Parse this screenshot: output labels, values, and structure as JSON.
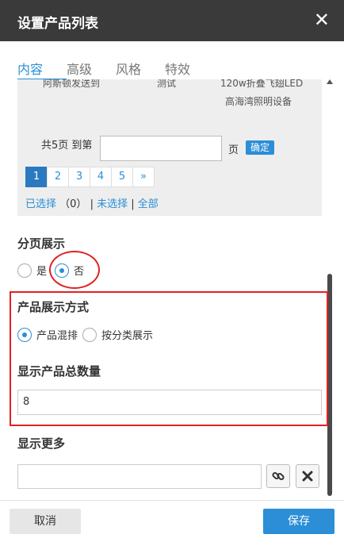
{
  "dialog": {
    "title": "设置产品列表",
    "close_glyph": "✕"
  },
  "tabs": [
    {
      "label": "内容",
      "active": true
    },
    {
      "label": "高级",
      "active": false
    },
    {
      "label": "风格",
      "active": false
    },
    {
      "label": "特效",
      "active": false
    }
  ],
  "product_list": {
    "items_partial": [
      "阿斯顿发送到",
      "测试",
      "120w折叠飞翅LED"
    ],
    "item_subtext": "高海湾照明设备",
    "total_pages_text": "共5页",
    "jump_to_text": "到第",
    "page_suffix": "页",
    "confirm_label": "确定",
    "pages": [
      "1",
      "2",
      "3",
      "4",
      "5",
      "»"
    ],
    "active_page": "1",
    "selected_prefix": "已选择",
    "selected_count": "（0）",
    "separator": "|",
    "unselected_label": "未选择",
    "all_label": "全部"
  },
  "pagination_display": {
    "title": "分页展示",
    "options": [
      {
        "label": "是",
        "checked": false
      },
      {
        "label": "否",
        "checked": true
      }
    ]
  },
  "product_display_mode": {
    "title": "产品展示方式",
    "options": [
      {
        "label": "产品混排",
        "checked": true
      },
      {
        "label": "按分类展示",
        "checked": false
      }
    ]
  },
  "total_count": {
    "title": "显示产品总数量",
    "value": "8"
  },
  "show_more": {
    "title": "显示更多",
    "value": "",
    "link_icon": "link-icon",
    "clear_icon": "close-icon"
  },
  "footer": {
    "cancel_label": "取消",
    "save_label": "保存"
  },
  "colors": {
    "accent": "#2b8ed6",
    "titlebar": "#3a3a3a",
    "highlight": "#e02222"
  }
}
